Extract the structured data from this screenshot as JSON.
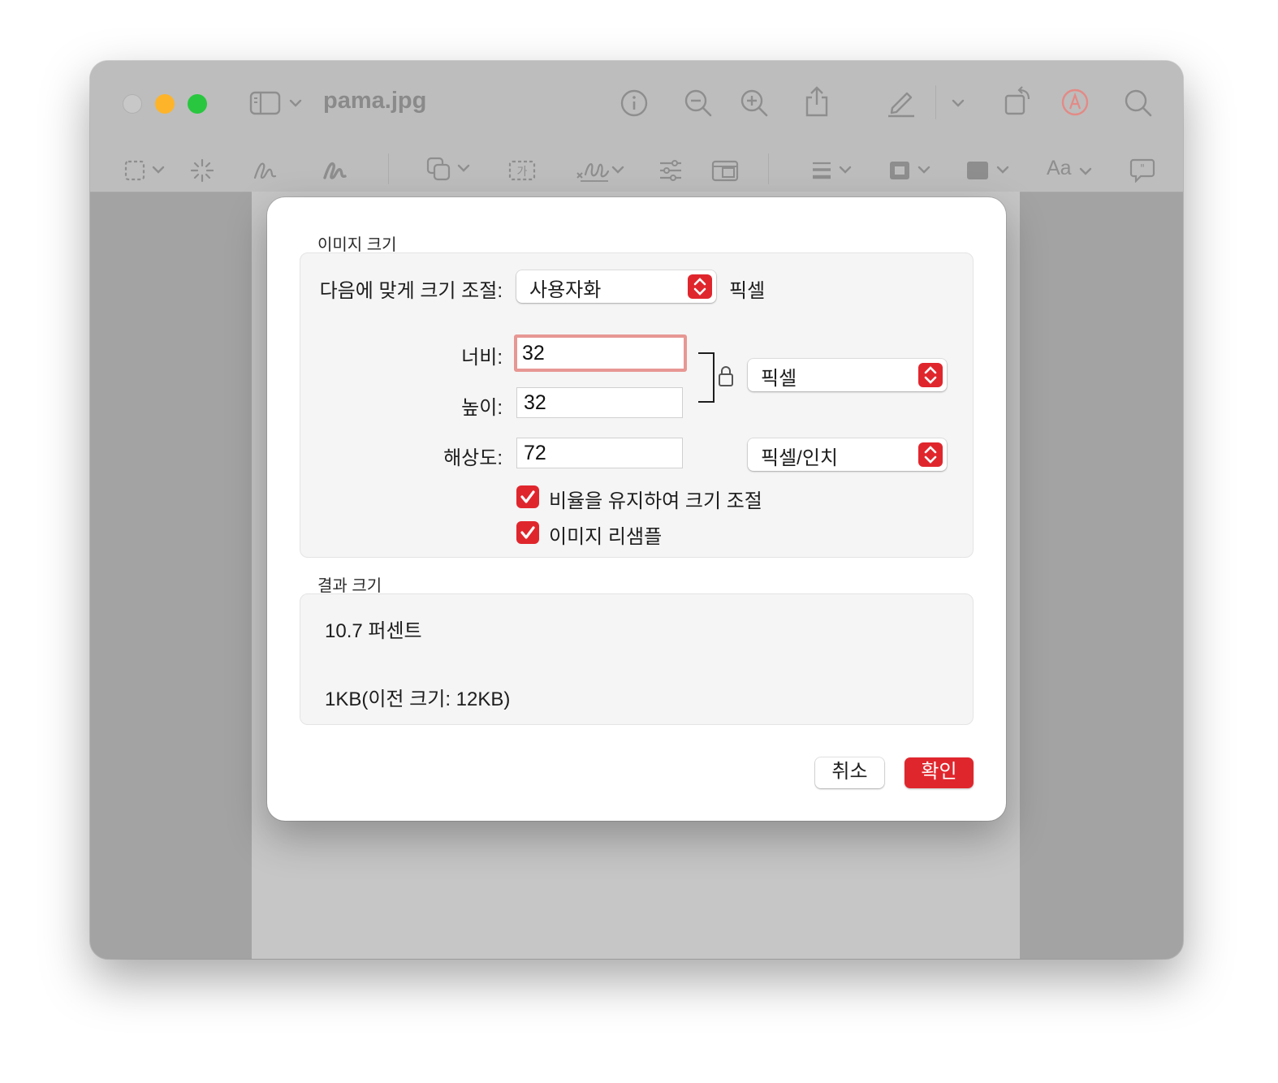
{
  "window": {
    "title": "pama.jpg"
  },
  "toolbar": {
    "icons": [
      "sidebar-icon",
      "chevron-down-icon",
      "info-icon",
      "zoom-out-icon",
      "zoom-in-icon",
      "share-icon",
      "markup-pen-icon",
      "chevron-down-icon",
      "rotate-icon",
      "markup-circle-icon",
      "search-icon"
    ]
  },
  "markup_toolbar": {
    "icons": [
      "rect-select-icon",
      "instant-alpha-icon",
      "sketch-icon",
      "draw-icon",
      "shapes-icon",
      "text-icon",
      "signature-icon",
      "adjust-color-icon",
      "adjust-size-icon",
      "shape-style-icon",
      "border-color-icon",
      "fill-color-icon",
      "text-style-icon",
      "note-icon"
    ],
    "text_style_label": "Aa"
  },
  "dialog": {
    "image_size_label": "이미지 크기",
    "fit_into_label": "다음에 맞게 크기 조절:",
    "fit_into_value": "사용자화",
    "fit_into_unit": "픽셀",
    "width_label": "너비:",
    "width_value": "32",
    "height_label": "높이:",
    "height_value": "32",
    "resolution_label": "해상도:",
    "resolution_value": "72",
    "size_unit": "픽셀",
    "resolution_unit": "픽셀/인치",
    "scale_proportionally_label": "비율을 유지하여 크기 조절",
    "scale_proportionally_checked": true,
    "resample_label": "이미지 리샘플",
    "resample_checked": true,
    "resulting_size_label": "결과 크기",
    "percent_text": "10.7 퍼센트",
    "filesize_text": "1KB(이전 크기: 12KB)",
    "cancel_label": "취소",
    "ok_label": "확인"
  },
  "colors": {
    "accent": "#e0262d",
    "focus_ring": "#e79794"
  }
}
